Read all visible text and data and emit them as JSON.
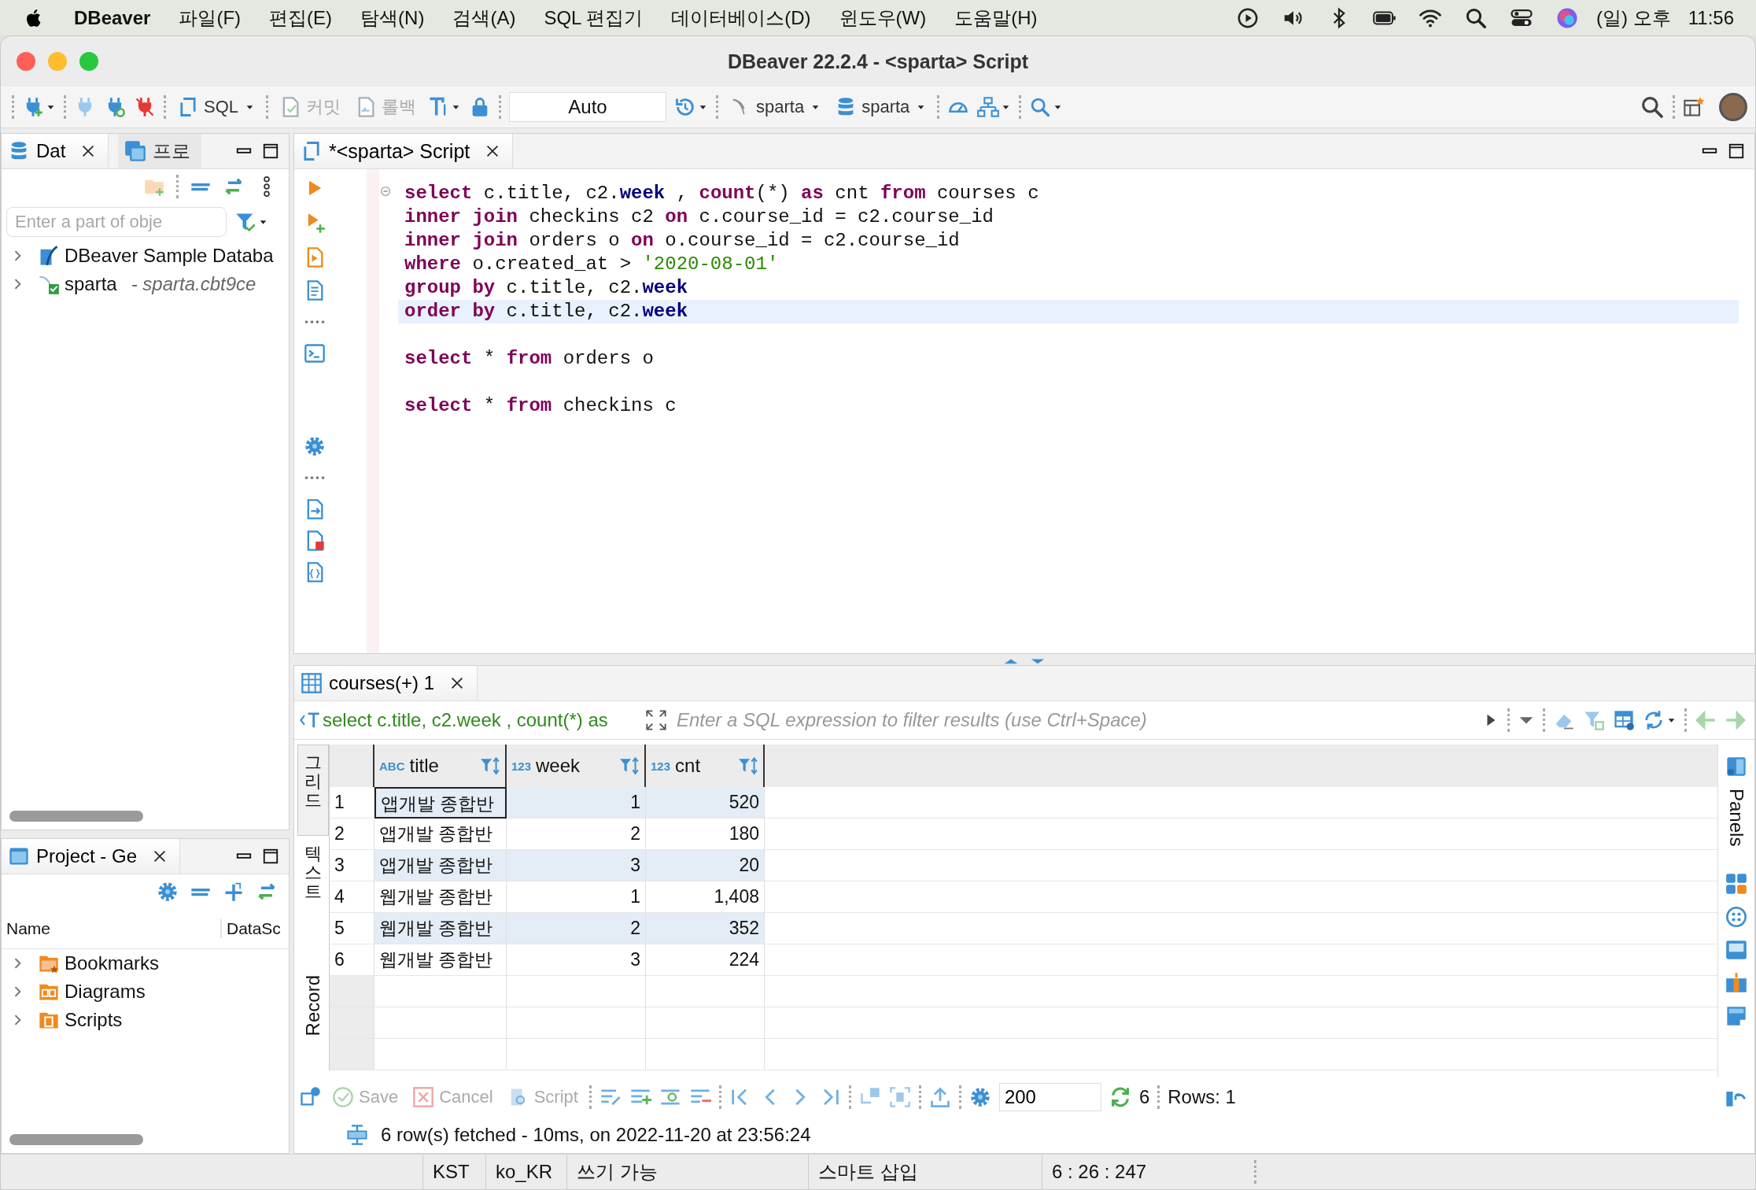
{
  "menu_bar": {
    "app": "DBeaver",
    "items": [
      "파일(F)",
      "편집(E)",
      "탐색(N)",
      "검색(A)",
      "SQL 편집기",
      "데이터베이스(D)",
      "윈도우(W)",
      "도움말(H)"
    ],
    "clock_day": "(일) 오후",
    "clock_time": "11:56"
  },
  "window": {
    "title": "DBeaver 22.2.4 - <sparta> Script"
  },
  "toolbar": {
    "sql": "SQL",
    "commit": {
      "label": "커밋",
      "disabled": true
    },
    "rollback": {
      "label": "롤백",
      "disabled": true
    },
    "transaction_mode": "Auto",
    "datasource": "sparta",
    "schema": "sparta"
  },
  "navigator": {
    "tabs": [
      {
        "label": "Dat",
        "selected": true
      },
      {
        "label": "프로",
        "selected": false
      }
    ],
    "search": {
      "placeholder": "Enter a part of obje"
    },
    "tree": [
      {
        "kind": "sqlite",
        "label": "DBeaver Sample Databa",
        "expanded": false
      },
      {
        "kind": "mysql",
        "label": "sparta",
        "detail": "- sparta.cbt9ce",
        "expanded": false
      }
    ]
  },
  "project": {
    "tab": "Project - Ge",
    "columns": [
      "Name",
      "DataSc"
    ],
    "items": [
      {
        "kind": "bookmarks",
        "label": "Bookmarks",
        "expanded": false
      },
      {
        "kind": "diagrams",
        "label": "Diagrams",
        "expanded": false
      },
      {
        "kind": "scripts",
        "label": "Scripts",
        "expanded": false
      }
    ]
  },
  "editor": {
    "tab": "*<sparta> Script",
    "lines": [
      {
        "kind": "code",
        "selected": false,
        "tokens": [
          {
            "kind": "keyword",
            "text": "select"
          },
          {
            "kind": "plain",
            "text": " c.title, c2."
          },
          {
            "kind": "column",
            "text": "week"
          },
          {
            "kind": "plain",
            "text": " , "
          },
          {
            "kind": "keyword",
            "text": "count"
          },
          {
            "kind": "plain",
            "text": "(*) "
          },
          {
            "kind": "keyword",
            "text": "as"
          },
          {
            "kind": "plain",
            "text": " cnt "
          },
          {
            "kind": "keyword",
            "text": "from"
          },
          {
            "kind": "plain",
            "text": " courses c"
          }
        ]
      },
      {
        "kind": "code",
        "selected": false,
        "tokens": [
          {
            "kind": "keyword",
            "text": "inner join"
          },
          {
            "kind": "plain",
            "text": " checkins c2 "
          },
          {
            "kind": "keyword",
            "text": "on"
          },
          {
            "kind": "plain",
            "text": " c.course_id = c2.course_id"
          }
        ]
      },
      {
        "kind": "code",
        "selected": false,
        "tokens": [
          {
            "kind": "keyword",
            "text": "inner join"
          },
          {
            "kind": "plain",
            "text": " orders o "
          },
          {
            "kind": "keyword",
            "text": "on"
          },
          {
            "kind": "plain",
            "text": " o.course_id = c2.course_id"
          }
        ]
      },
      {
        "kind": "code",
        "selected": false,
        "tokens": [
          {
            "kind": "keyword",
            "text": "where"
          },
          {
            "kind": "plain",
            "text": " o.created_at > "
          },
          {
            "kind": "string",
            "text": "'2020-08-01'"
          }
        ]
      },
      {
        "kind": "code",
        "selected": false,
        "tokens": [
          {
            "kind": "keyword",
            "text": "group by"
          },
          {
            "kind": "plain",
            "text": " c.title, c2."
          },
          {
            "kind": "column",
            "text": "week"
          }
        ]
      },
      {
        "kind": "code",
        "selected": true,
        "tokens": [
          {
            "kind": "keyword",
            "text": "order by"
          },
          {
            "kind": "plain",
            "text": " c.title, c2."
          },
          {
            "kind": "column",
            "text": "week"
          }
        ]
      },
      {
        "kind": "blank"
      },
      {
        "kind": "code",
        "selected": false,
        "tokens": [
          {
            "kind": "keyword",
            "text": "select"
          },
          {
            "kind": "plain",
            "text": " * "
          },
          {
            "kind": "keyword",
            "text": "from"
          },
          {
            "kind": "plain",
            "text": " orders o"
          }
        ]
      },
      {
        "kind": "blank"
      },
      {
        "kind": "code",
        "selected": false,
        "tokens": [
          {
            "kind": "keyword",
            "text": "select"
          },
          {
            "kind": "plain",
            "text": " * "
          },
          {
            "kind": "keyword",
            "text": "from"
          },
          {
            "kind": "plain",
            "text": " checkins c"
          }
        ]
      }
    ]
  },
  "results": {
    "tab": "courses(+) 1",
    "query": "select c.title, c2.week , count(*) as",
    "filter": {
      "placeholder": "Enter a SQL expression to filter results (use Ctrl+Space)"
    },
    "view_tabs": [
      {
        "kind": "cjk",
        "label": "그리드",
        "selected": true
      },
      {
        "kind": "cjk",
        "label": "텍스트",
        "selected": false
      },
      {
        "kind": "latin",
        "label": "Record",
        "selected": false
      }
    ],
    "columns": [
      {
        "type": "ABC",
        "name": "title"
      },
      {
        "type": "123",
        "name": "week"
      },
      {
        "type": "123",
        "name": "cnt"
      }
    ],
    "rows": [
      {
        "number": "1",
        "cells": [
          "앱개발 종합반",
          "1",
          "520"
        ],
        "selected": true
      },
      {
        "number": "2",
        "cells": [
          "앱개발 종합반",
          "2",
          "180"
        ],
        "selected": false
      },
      {
        "number": "3",
        "cells": [
          "앱개발 종합반",
          "3",
          "20"
        ],
        "selected": false
      },
      {
        "number": "4",
        "cells": [
          "웹개발 종합반",
          "1",
          "1,408"
        ],
        "selected": false
      },
      {
        "number": "5",
        "cells": [
          "웹개발 종합반",
          "2",
          "352"
        ],
        "selected": false
      },
      {
        "number": "6",
        "cells": [
          "웹개발 종합반",
          "3",
          "224"
        ],
        "selected": false
      }
    ],
    "panels": "Panels",
    "actions": [
      {
        "label": "Save",
        "disabled": true,
        "kind": "save"
      },
      {
        "label": "Cancel",
        "disabled": true,
        "kind": "cancel"
      },
      {
        "label": "Script",
        "disabled": true,
        "kind": "script"
      }
    ],
    "fetch_size": "200",
    "refresh_count": "6",
    "row_info": "Rows: 1",
    "log": "6 row(s) fetched - 10ms, on 2022-11-20 at 23:56:24"
  },
  "status_bar": [
    "KST",
    "ko_KR",
    "쓰기 가능",
    "스마트 삽입",
    "6 : 26 : 247"
  ]
}
